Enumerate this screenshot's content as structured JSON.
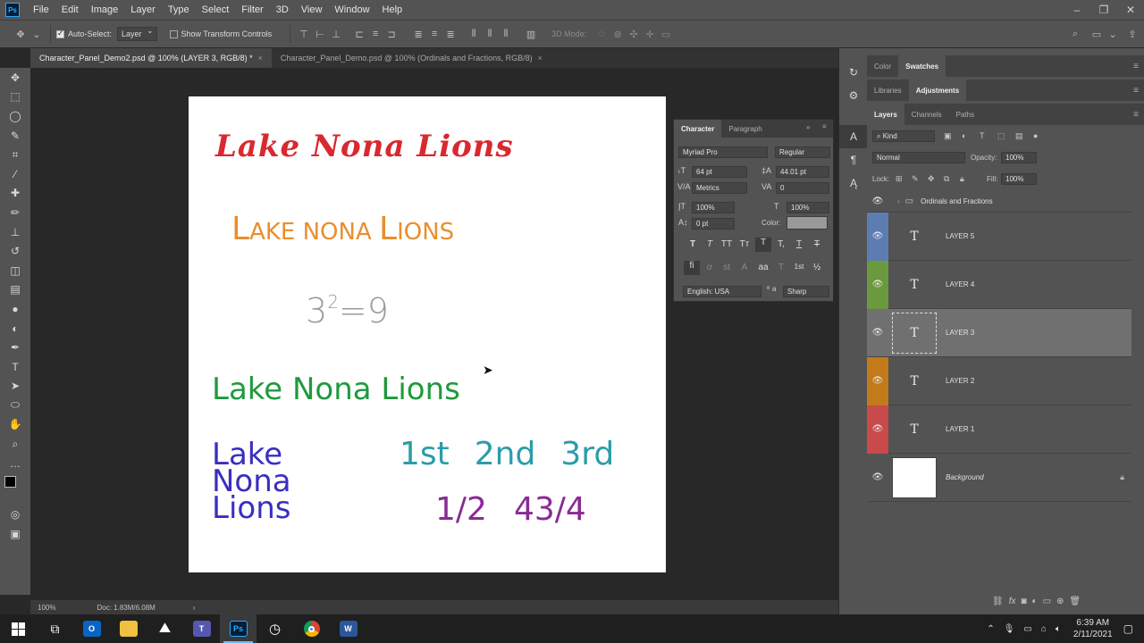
{
  "app": {
    "logo": "Ps",
    "menu": [
      "File",
      "Edit",
      "Image",
      "Layer",
      "Type",
      "Select",
      "Filter",
      "3D",
      "View",
      "Window",
      "Help"
    ]
  },
  "options": {
    "auto_select_label": "Auto-Select:",
    "auto_select_value": "Layer",
    "transform_label": "Show Transform Controls",
    "mode_3d_label": "3D Mode:"
  },
  "tabs": [
    {
      "label": "Character_Panel_Demo2.psd @ 100% (LAYER 3, RGB/8) *",
      "close": "×"
    },
    {
      "label": "Character_Panel_Demo.psd @ 100% (Ordinals and Fractions, RGB/8)",
      "close": "×"
    }
  ],
  "canvas": {
    "line1": "Lake Nona Lions",
    "line2_cap1": "L",
    "line2_sc1": "AKE NONA ",
    "line2_cap2": "L",
    "line2_sc2": "IONS",
    "line3_base": "3",
    "line3_sup": "2",
    "line3_rest": "=9",
    "line4": "Lake Nona Lions",
    "stack": [
      "Lake",
      "Nona",
      "Lions"
    ],
    "ordinals": [
      "1st",
      "2nd",
      "3rd"
    ],
    "fractions": [
      "1/2",
      "43/4"
    ]
  },
  "status": {
    "zoom": "100%",
    "doc": "Doc: 1.83M/6.08M",
    "arrow": "›"
  },
  "character": {
    "tab_character": "Character",
    "tab_paragraph": "Paragraph",
    "font_family": "Myriad Pro",
    "font_style": "Regular",
    "font_size": "64 pt",
    "leading": "44.01 pt",
    "kerning": "Metrics",
    "tracking": "0",
    "vscale": "100%",
    "hscale": "100%",
    "baseline": "0 pt",
    "color_label": "Color:",
    "language": "English: USA",
    "aa_label": "a",
    "antialias": "Sharp",
    "style_buttons": [
      "T",
      "T",
      "TT",
      "Tт",
      "T",
      "T,",
      "T",
      "T"
    ],
    "opentype_buttons": [
      "fi",
      "ơ",
      "st",
      "A",
      "aa",
      "T",
      "1st",
      "½"
    ]
  },
  "panels": {
    "color_tab": "Color",
    "swatches_tab": "Swatches",
    "libraries_tab": "Libraries",
    "adjustments_tab": "Adjustments",
    "layers_tab": "Layers",
    "channels_tab": "Channels",
    "paths_tab": "Paths",
    "kind_label": "Kind",
    "blend_mode": "Normal",
    "opacity_label": "Opacity:",
    "opacity_value": "100%",
    "lock_label": "Lock:",
    "fill_label": "Fill:",
    "fill_value": "100%"
  },
  "layers": {
    "group_name": "Ordinals and Fractions",
    "items": [
      {
        "name": "LAYER 5",
        "type_glyph": "T",
        "color": "#5d7db2"
      },
      {
        "name": "LAYER 4",
        "type_glyph": "T",
        "color": "#6a9a3d"
      },
      {
        "name": "LAYER 3",
        "type_glyph": "T",
        "color": "#535353"
      },
      {
        "name": "LAYER 2",
        "type_glyph": "T",
        "color": "#c27a1a"
      },
      {
        "name": "LAYER 1",
        "type_glyph": "T",
        "color": "#c84a4a"
      },
      {
        "name": "Background",
        "type_glyph": "",
        "color": "#535353"
      }
    ]
  },
  "taskbar": {
    "time": "6:39 AM",
    "date": "2/11/2021",
    "ps_label": "Ps",
    "word_label": "W",
    "outlook_label": "O"
  },
  "colors": {
    "red": "#d9282f",
    "orange": "#e98e2e",
    "gray": "#9a9a9a",
    "green": "#1f9a3d",
    "blue": "#3a2fc0",
    "teal": "#2a9da8",
    "purple": "#8a2a95"
  }
}
